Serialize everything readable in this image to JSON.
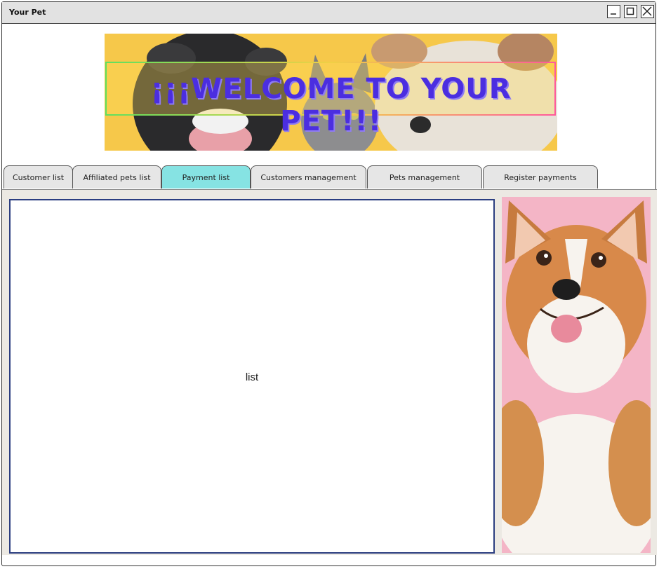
{
  "window": {
    "title": "Your Pet"
  },
  "banner": {
    "text": "¡¡¡WELCOME TO YOUR PET!!!"
  },
  "tabs": [
    {
      "label": "Customer list",
      "active": false
    },
    {
      "label": "Affiliated pets list",
      "active": false
    },
    {
      "label": "Payment list",
      "active": true
    },
    {
      "label": "Customers management",
      "active": false
    },
    {
      "label": "Pets management",
      "active": false
    },
    {
      "label": "Register payments",
      "active": false
    }
  ],
  "main": {
    "list_placeholder": "list"
  },
  "colors": {
    "active_tab": "#86e3e3",
    "banner_text": "#4b2ee0",
    "banner_bg": "#f6c84a",
    "list_border": "#2c3e80"
  }
}
